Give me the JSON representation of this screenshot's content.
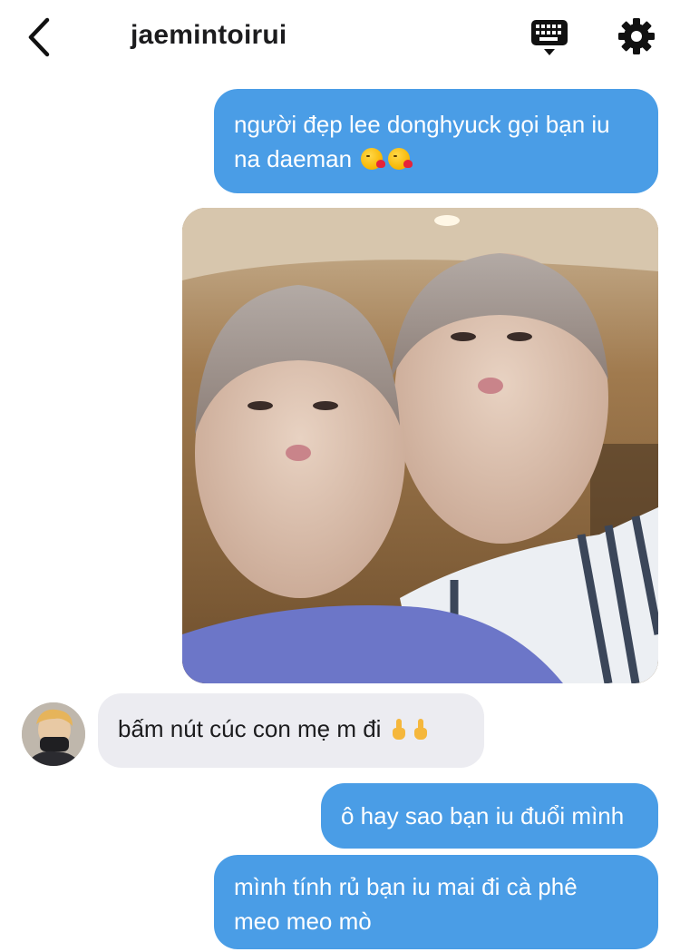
{
  "header": {
    "title": "jaemintoirui",
    "back_icon": "chevron-left-icon",
    "keyboard_icon": "keyboard-icon",
    "settings_icon": "gear-icon"
  },
  "colors": {
    "outgoing_bubble": "#4a9de6",
    "incoming_bubble": "#ececf1",
    "text_dark": "#1c1c1e"
  },
  "messages": [
    {
      "side": "outgoing",
      "lines": [
        "người đẹp lee donghyuck gọi bạn iu",
        "na daeman"
      ],
      "emoji": [
        "kissing-heart-emoji",
        "kissing-heart-emoji"
      ]
    },
    {
      "side": "outgoing",
      "type": "photo",
      "alt": "selfie photo"
    },
    {
      "side": "incoming",
      "text": "bấm nút cúc con mẹ m đi",
      "emoji": [
        "middle-finger-emoji",
        "middle-finger-emoji"
      ]
    },
    {
      "side": "outgoing",
      "text": "ô hay sao bạn iu đuổi mình"
    },
    {
      "side": "outgoing",
      "lines": [
        "mình tính rủ bạn iu mai đi cà phê",
        "meo meo mò"
      ]
    }
  ]
}
